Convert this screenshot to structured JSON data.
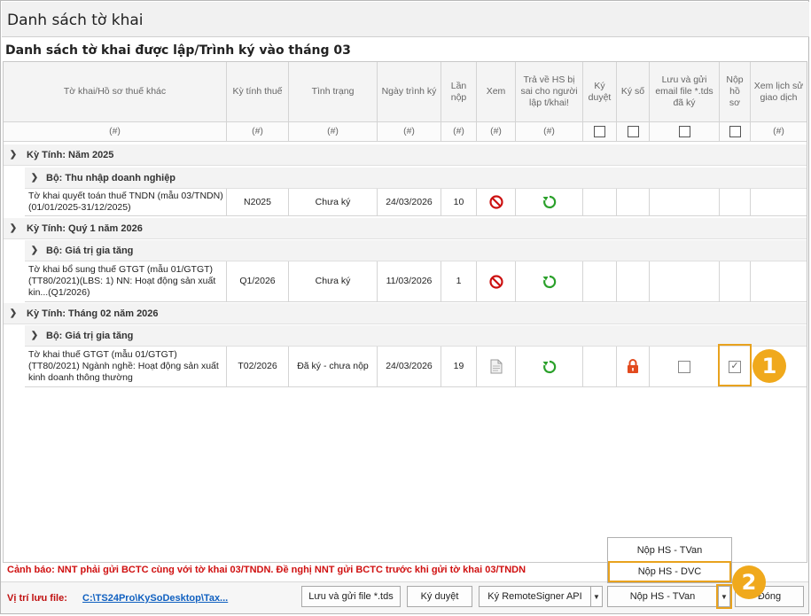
{
  "window": {
    "title": "Danh sách tờ khai"
  },
  "subtitle": "Danh sách tờ khai được lập/Trình ký vào tháng 03",
  "columns": {
    "to_khai": "Tờ khai/Hồ sơ thuế khác",
    "ky_tinh_thue": "Kỳ tính thuế",
    "tinh_trang": "Tình trạng",
    "ngay_trinh_ky": "Ngày trình ký",
    "lan_nop": "Lần nộp",
    "xem": "Xem",
    "tra_ve": "Trả về HS bị sai cho người lập t/khai!",
    "ky_duyet": "Ký duyệt",
    "ky_so": "Ký số",
    "luu_gui": "Lưu và gửi email file *.tds đã ký",
    "nop_ho_so": "Nộp hồ sơ",
    "xem_lich_su": "Xem lịch sử giao dịch"
  },
  "filter_placeholder": "(#)",
  "groups": {
    "g1": "Kỳ Tính: Năm 2025",
    "g1_sub": "Bộ: Thu nhập doanh nghiệp",
    "g2": "Kỳ Tính: Quý 1 năm 2026",
    "g2_sub": "Bộ: Giá trị gia tăng",
    "g3": "Kỳ Tính: Tháng 02 năm 2026",
    "g3_sub": "Bộ: Giá trị gia tăng"
  },
  "rows": [
    {
      "name": "Tờ khai quyết toán thuế TNDN (mẫu 03/TNDN)(01/01/2025-31/12/2025)",
      "ky": "N2025",
      "tinh_trang": "Chưa ký",
      "ngay": "24/03/2026",
      "lan": "10"
    },
    {
      "name": "Tờ khai bổ sung thuế GTGT (mẫu 01/GTGT)(TT80/2021)(LBS: 1) NN: Hoạt động sản xuất kin...(Q1/2026)",
      "ky": "Q1/2026",
      "tinh_trang": "Chưa ký",
      "ngay": "11/03/2026",
      "lan": "1"
    },
    {
      "name": "Tờ khai thuế GTGT (mẫu 01/GTGT)(TT80/2021) Ngành nghề: Hoạt động sản xuất kinh doanh thông thường",
      "ky": "T02/2026",
      "tinh_trang": "Đã ký - chưa nộp",
      "ngay": "24/03/2026",
      "lan": "19"
    }
  ],
  "badges": {
    "one": "1",
    "two": "2"
  },
  "warning": "Cảnh báo: NNT phải gửi BCTC cùng với tờ khai 03/TNDN. Đề nghị NNT gửi BCTC trước khi gửi tờ khai 03/TNDN",
  "path": {
    "label": "Vị trí lưu file:",
    "value": "C:\\TS24Pro\\KySoDesktop\\Tax..."
  },
  "buttons": {
    "luu_gui": "Lưu và gửi file *.tds",
    "ky_duyet": "Ký duyệt",
    "ky_remote": "Ký RemoteSigner API",
    "nop_hs": "Nộp HS - TVan",
    "dong": "Đóng"
  },
  "popup": {
    "item1": "Nộp HS - TVan",
    "item2": "Nộp HS - DVC"
  },
  "colors": {
    "accent": "#f0a91c",
    "warning": "#d01010",
    "link": "#1060c0",
    "green": "#2aa02a",
    "red": "#cc1111"
  }
}
